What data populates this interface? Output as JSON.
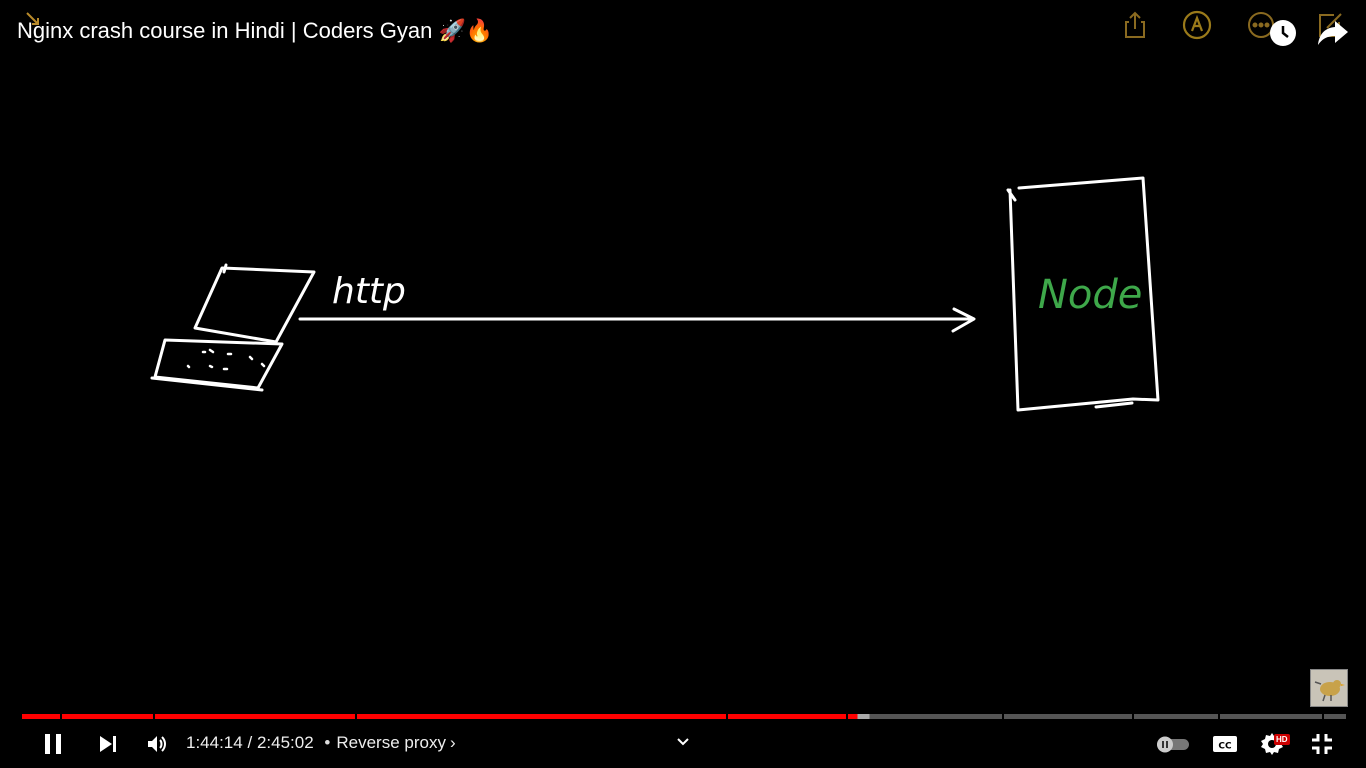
{
  "video": {
    "title": "Nginx crash course in Hindi | Coders Gyan 🚀🔥"
  },
  "drawing": {
    "protocol_label": "http",
    "server_label": "Node",
    "server_label_color": "#3ea84a",
    "stroke_color": "#ffffff"
  },
  "player": {
    "current_time": "1:44:14",
    "time_separator": "/",
    "duration": "2:45:02",
    "chapter_separator": "•",
    "chapter_title": "Reverse proxy",
    "chapter_chevron": "›",
    "progress_played_fraction": 0.631,
    "progress_buffered_fraction": 0.64,
    "accent_color": "#ff0000",
    "hd_badge": "HD",
    "autoplay_enabled": false
  },
  "icons": {
    "top": [
      "share-icon",
      "annotation-icon",
      "more-icon",
      "edit-icon",
      "watch-later-icon",
      "share-arrow-icon"
    ],
    "controls": [
      "pause-icon",
      "next-icon",
      "volume-icon",
      "chevron-down-icon",
      "autoplay-toggle",
      "captions-icon",
      "settings-icon",
      "exit-fullscreen-icon"
    ]
  }
}
